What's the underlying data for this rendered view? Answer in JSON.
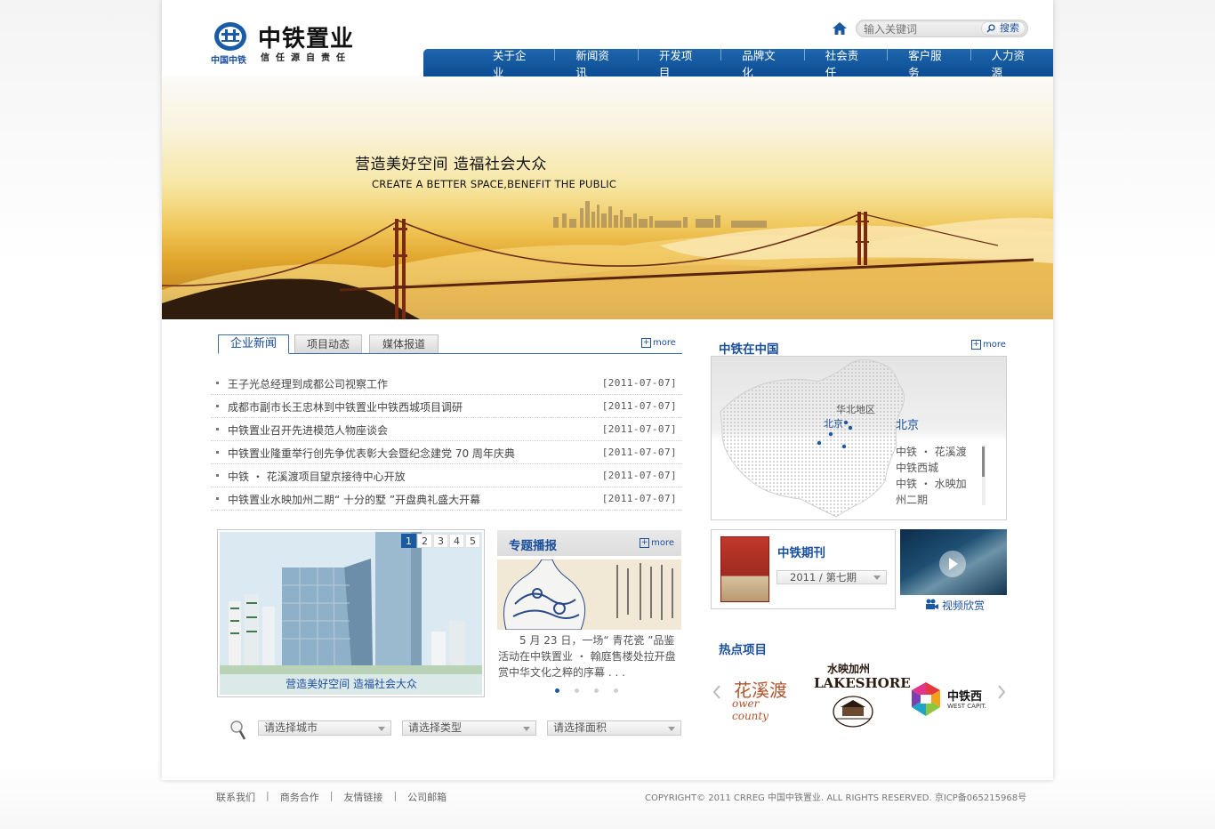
{
  "brand": {
    "logo_small_text": "中国中铁",
    "title": "中铁置业",
    "slogan": "信任源自责任"
  },
  "search": {
    "placeholder": "输入关键词",
    "button_label": "搜索"
  },
  "nav": {
    "items": [
      {
        "label": "关于企业"
      },
      {
        "label": "新闻资讯"
      },
      {
        "label": "开发项目"
      },
      {
        "label": "品牌文化"
      },
      {
        "label": "社会责任"
      },
      {
        "label": "客户服务"
      },
      {
        "label": "人力资源"
      }
    ]
  },
  "banner": {
    "title": "营造美好空间  造福社会大众",
    "subtitle": "CREATE A BETTER SPACE,BENEFIT THE PUBLIC"
  },
  "news": {
    "tabs": [
      {
        "label": "企业新闻",
        "active": true
      },
      {
        "label": "项目动态",
        "active": false
      },
      {
        "label": "媒体报道",
        "active": false
      }
    ],
    "more_label": "more",
    "items": [
      {
        "title": "王子光总经理到成都公司视察工作",
        "date": "[2011-07-07]"
      },
      {
        "title": "成都市副市长王忠林到中铁置业中铁西城项目调研",
        "date": "[2011-07-07]"
      },
      {
        "title": "中铁置业召开先进模范人物座谈会",
        "date": "[2011-07-07]"
      },
      {
        "title": "中铁置业隆重举行创先争优表彰大会暨纪念建党 70 周年庆典",
        "date": "[2011-07-07]"
      },
      {
        "title": "中铁 ・ 花溪渡项目望京接待中心开放",
        "date": "[2011-07-07]"
      },
      {
        "title": "中铁置业水映加州二期“ 十分的墅 ”开盘典礼盛大开幕",
        "date": "[2011-07-07]"
      }
    ]
  },
  "slideshow": {
    "caption": "营造美好空间  造福社会大众",
    "pages": [
      "1",
      "2",
      "3",
      "4",
      "5"
    ],
    "active_page": 1
  },
  "special": {
    "title": "专题播报",
    "more_label": "more",
    "text": "5 月 23 日，一场“ 青花瓷 ”品鉴活动在中铁置业 ・ 翰庭售楼处拉开盘赏中华文化之粹的序幕 . . .",
    "dots": 4,
    "active_dot": 1
  },
  "filters": [
    {
      "label": "请选择城市"
    },
    {
      "label": "请选择类型"
    },
    {
      "label": "请选择面积"
    }
  ],
  "map": {
    "title": "中铁在中国",
    "more_label": "more",
    "region_label": "华北地区",
    "pin_label": "北京",
    "city": "北京",
    "projects": [
      "中铁 ・ 花溪渡",
      "中铁西城",
      "中铁 ・ 水映加",
      "州二期"
    ]
  },
  "journal": {
    "title": "中铁期刊",
    "issue": "2011 / 第七期"
  },
  "video": {
    "label": "视频欣赏"
  },
  "hot": {
    "title": "热点项目",
    "logos": [
      {
        "name": "花溪渡",
        "sub": "ower county"
      },
      {
        "name": "水映加州",
        "sub": "LAKESHORE"
      },
      {
        "name": "中铁西",
        "sub": "WEST CAPIT."
      }
    ]
  },
  "footer": {
    "links": [
      "联系我们",
      "商务合作",
      "友情链接",
      "公司邮箱"
    ],
    "copyright": "COPYRIGHT© 2011 CRREG 中国中铁置业.  ALL RIGHTS RESERVED.  京ICP备065215968号"
  },
  "colors": {
    "brand_blue": "#0c4d93",
    "link_blue": "#1a4f9c"
  }
}
